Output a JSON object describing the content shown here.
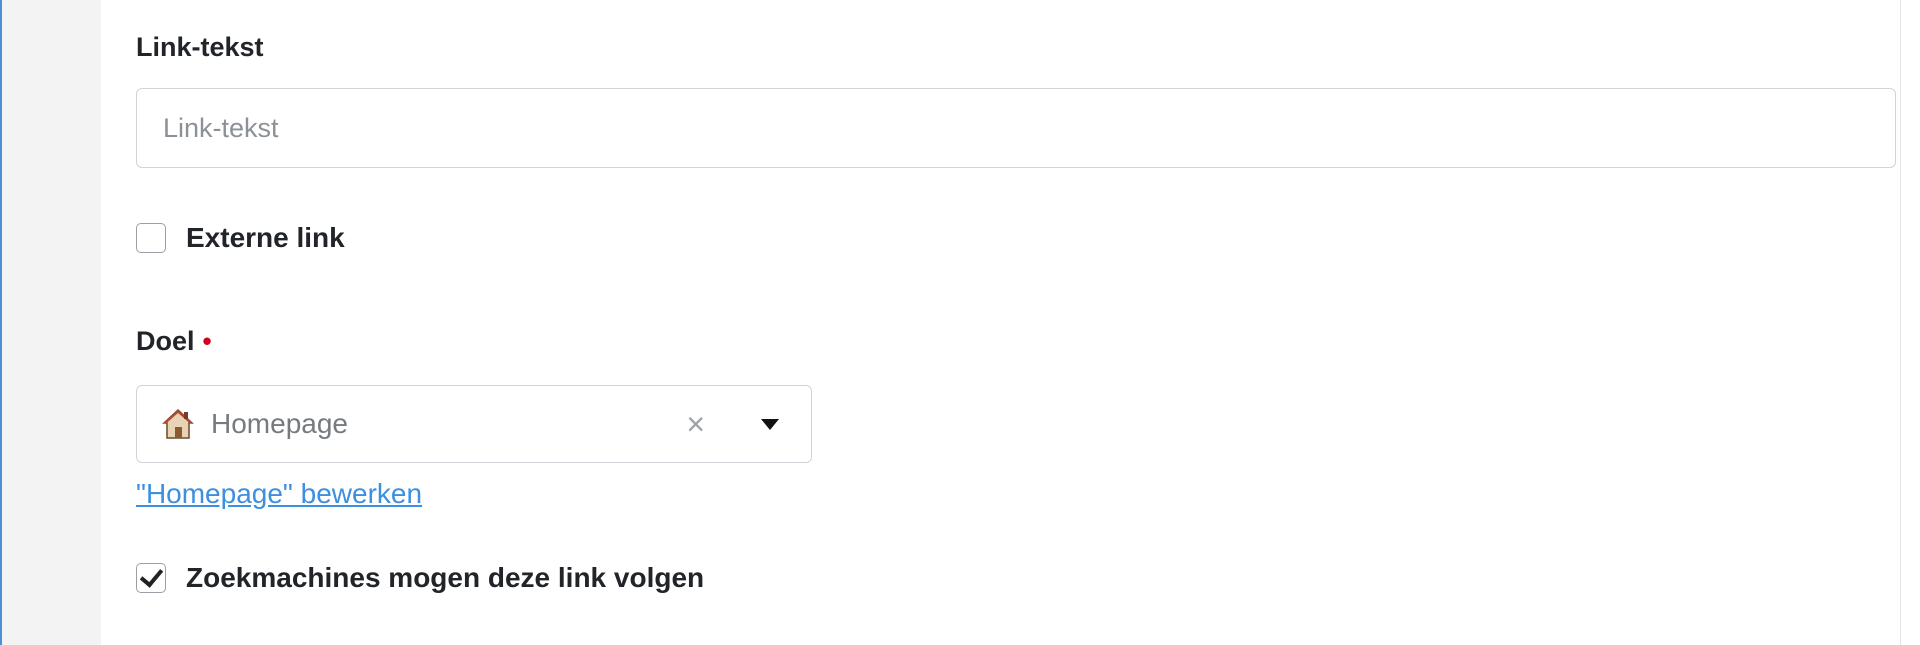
{
  "link_text": {
    "label": "Link-tekst",
    "placeholder": "Link-tekst",
    "value": ""
  },
  "external_link": {
    "label": "Externe link",
    "checked": false
  },
  "target": {
    "label": "Doel",
    "required_mark": "•",
    "selected_value": "Homepage",
    "clear_symbol": "×",
    "edit_link": "\"Homepage\" bewerken",
    "icon": "house-icon"
  },
  "follow_links": {
    "label": "Zoekmachines mogen deze link volgen",
    "checked": true
  },
  "colors": {
    "accent_link": "#3d8fe0",
    "required": "#d0021b",
    "side_border": "#4a90d9"
  }
}
